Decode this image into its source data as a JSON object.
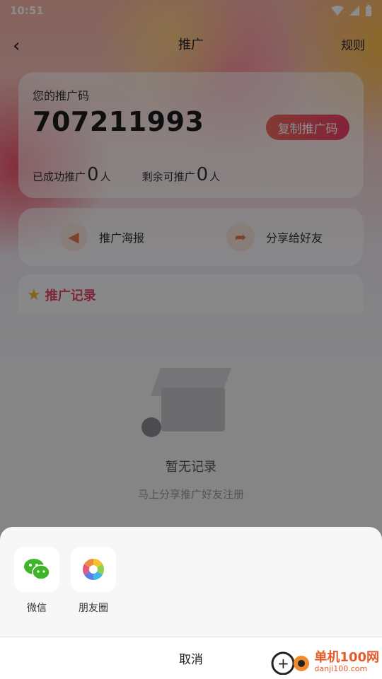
{
  "status": {
    "time": "10:51"
  },
  "nav": {
    "back": "‹",
    "title": "推广",
    "rules": "规则"
  },
  "code_card": {
    "label": "您的推广码",
    "code": "707211993",
    "copy_button": "复制推广码",
    "success_label": "已成功推广",
    "success_count": "0",
    "success_unit": "人",
    "remaining_label": "剩余可推广",
    "remaining_count": "0",
    "remaining_unit": "人"
  },
  "share_card": {
    "poster": "推广海报",
    "share_friends": "分享给好友"
  },
  "records": {
    "title": "推广记录"
  },
  "empty": {
    "title": "暂无记录",
    "subtitle": "马上分享推广好友注册"
  },
  "share_sheet": {
    "items": [
      {
        "label": "微信",
        "icon": "wechat-icon"
      },
      {
        "label": "朋友圈",
        "icon": "moments-icon"
      }
    ],
    "cancel": "取消"
  },
  "watermark": {
    "cn": "单机100网",
    "en": "danji100.com"
  }
}
